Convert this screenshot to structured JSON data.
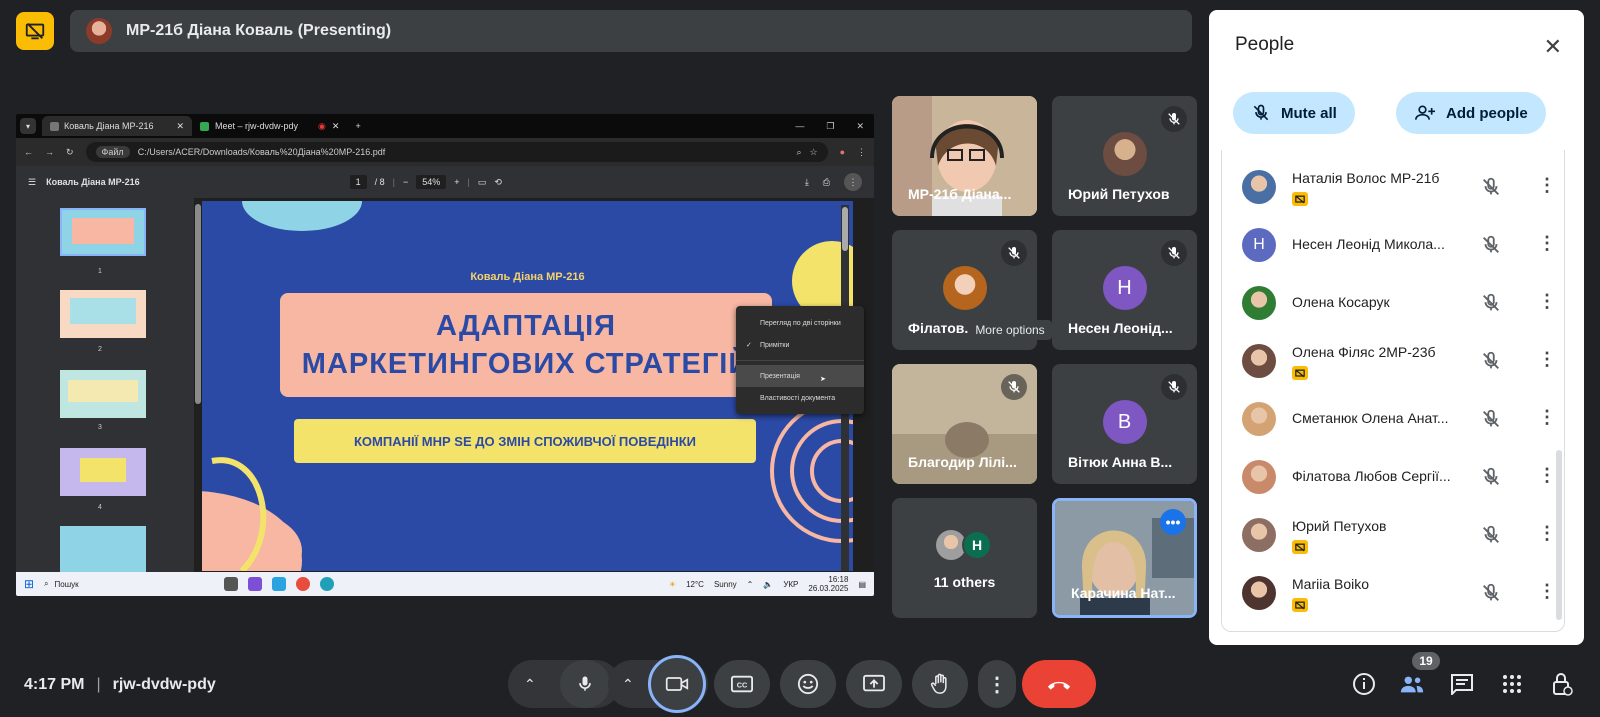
{
  "presenting": {
    "banner": "МР-21б Діана Коваль (Presenting)"
  },
  "shared_screen": {
    "browser": {
      "tabs": [
        "Коваль Діана МР-216",
        "Meet – rjw-dvdw-pdy"
      ],
      "new_tab": "+",
      "address_chip": "Файл",
      "address": "C:/Users/ACER/Downloads/Коваль%20Діана%20МР-216.pdf"
    },
    "pdf": {
      "doc_title": "Коваль Діана МР-216",
      "page": "1",
      "page_total": "/ 8",
      "zoom": "54%",
      "thumb_numbers": [
        "1",
        "2",
        "3",
        "4"
      ]
    },
    "slide": {
      "author": "Коваль Діана МР-216",
      "title_line1": "АДАПТАЦІЯ",
      "title_line2": "МАРКЕТИНГОВИХ СТРАТЕГІЙ",
      "subtitle": "КОМПАНІЇ МНР SE ДО ЗМІН СПОЖИВЧОЇ ПОВЕДІНКИ"
    },
    "context_menu": {
      "items": [
        "Перегляд по дві сторінки",
        "Примітки",
        "Презентація",
        "Властивості документа"
      ],
      "checked": "Примітки",
      "highlighted": "Презентація"
    },
    "taskbar": {
      "search": "Пошук",
      "weather_temp": "12°C",
      "weather_text": "Sunny",
      "lang": "УКР",
      "time": "16:18",
      "date": "26.03.2025"
    }
  },
  "tiles": [
    {
      "name": "МР-21б Діана...",
      "muted": false
    },
    {
      "name": "Юрий Петухов",
      "muted": true
    },
    {
      "name": "Філатов...",
      "muted": true
    },
    {
      "name": "Несен Леонід...",
      "muted": true,
      "initial": "Н",
      "color": "#7e57c2"
    },
    {
      "name": "Благодир Лілі...",
      "muted": true
    },
    {
      "name": "Вітюк Анна В...",
      "muted": true,
      "initial": "В",
      "color": "#7e57c2"
    },
    {
      "name": "11 others",
      "muted": false,
      "initial": "Н",
      "color": "#0b6e4f"
    },
    {
      "name": "Карачина Нат...",
      "muted": false
    }
  ],
  "tooltip": "More options",
  "people_panel": {
    "title": "People",
    "mute_all": "Mute all",
    "add_people": "Add people",
    "people": [
      {
        "name": "Наталія Волос МР-21б",
        "presenting_badge": true,
        "color": "#4a6fa5"
      },
      {
        "name": "Несен Леонід Микола...",
        "presenting_badge": false,
        "initial": "Н",
        "color": "#5c6bc0"
      },
      {
        "name": "Олена Косарук",
        "presenting_badge": false,
        "color": "#2e7d32"
      },
      {
        "name": "Олена Філяс 2МР-23б",
        "presenting_badge": true,
        "color": "#6d4c41"
      },
      {
        "name": "Сметанюк Олена Анат...",
        "presenting_badge": false,
        "color": "#d4a373"
      },
      {
        "name": "Філатова Любов Сергії...",
        "presenting_badge": false,
        "color": "#c98a6b"
      },
      {
        "name": "Юрий Петухов",
        "presenting_badge": true,
        "color": "#8d6e63"
      },
      {
        "name": "Mariia Boiko",
        "presenting_badge": true,
        "color": "#4e342e"
      }
    ]
  },
  "bottom": {
    "time": "4:17 PM",
    "meeting_code": "rjw-dvdw-pdy",
    "participant_count": "19"
  },
  "colors": {
    "background": "#202124",
    "accent_yellow": "#fbbc04",
    "leave_red": "#ea4335",
    "tonal_button": "#c2e7ff",
    "camera_ring": "#8ab4f8"
  }
}
